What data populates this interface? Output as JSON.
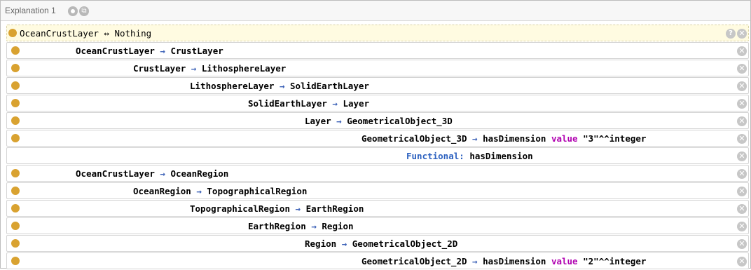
{
  "panel": {
    "title": "Explanation 1",
    "title_icons": [
      "radio-icon",
      "copy-icon"
    ]
  },
  "header_axiom": {
    "subject": "OceanCrustLayer",
    "symbol": "↔",
    "object": "Nothing"
  },
  "rows": [
    {
      "subject": "OceanCrustLayer",
      "symbol": "→",
      "object": "CrustLayer"
    },
    {
      "subject": "CrustLayer",
      "symbol": "→",
      "object": "LithosphereLayer"
    },
    {
      "subject": "LithosphereLayer",
      "symbol": "→",
      "object": "SolidEarthLayer"
    },
    {
      "subject": "SolidEarthLayer",
      "symbol": "→",
      "object": "Layer"
    },
    {
      "subject": "Layer",
      "symbol": "→",
      "object": "GeometricalObject_3D"
    },
    {
      "subject": "GeometricalObject_3D",
      "symbol": "→",
      "object": "hasDimension",
      "keyword": "value",
      "literal": "\"3\"^^integer"
    },
    {
      "label": "Functional:",
      "object": "hasDimension"
    },
    {
      "subject": "OceanCrustLayer",
      "symbol": "→",
      "object": "OceanRegion"
    },
    {
      "subject": "OceanRegion",
      "symbol": "→",
      "object": "TopographicalRegion"
    },
    {
      "subject": "TopographicalRegion",
      "symbol": "→",
      "object": "EarthRegion"
    },
    {
      "subject": "EarthRegion",
      "symbol": "→",
      "object": "Region"
    },
    {
      "subject": "Region",
      "symbol": "→",
      "object": "GeometricalObject_2D"
    },
    {
      "subject": "GeometricalObject_2D",
      "symbol": "→",
      "object": "hasDimension",
      "keyword": "value",
      "literal": "\"2\"^^integer"
    }
  ],
  "buttons": {
    "help_label": "?",
    "close_label": "✕"
  },
  "colors": {
    "bullet": "#d9a230",
    "arrow": "#3e63b8",
    "keyword": "#b000b0",
    "functional": "#2e62c0",
    "highlight_bg": "#fffbe1"
  }
}
